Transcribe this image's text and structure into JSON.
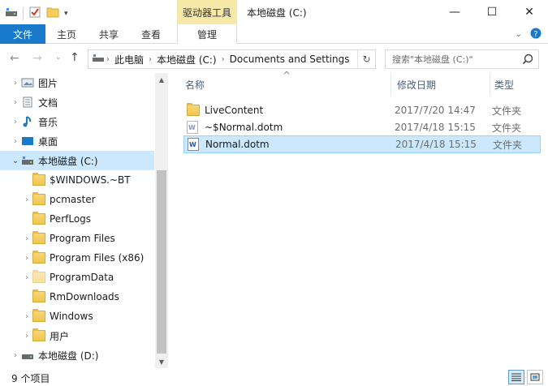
{
  "window": {
    "title": "本地磁盘 (C:)",
    "context_tab_group": "驱动器工具",
    "controls": {
      "minimize": "—",
      "maximize": "☐",
      "close": "✕"
    }
  },
  "ribbon": {
    "tabs": [
      "文件",
      "主页",
      "共享",
      "查看",
      "管理"
    ]
  },
  "address": {
    "crumbs": [
      "此电脑",
      "本地磁盘 (C:)",
      "Documents and Settings"
    ],
    "search_placeholder": "搜索\"本地磁盘 (C:)\""
  },
  "tree": {
    "items": [
      {
        "label": "图片",
        "icon": "pictures-icon"
      },
      {
        "label": "文档",
        "icon": "documents-icon"
      },
      {
        "label": "音乐",
        "icon": "music-icon"
      },
      {
        "label": "桌面",
        "icon": "desktop-icon"
      },
      {
        "label": "本地磁盘 (C:)",
        "icon": "drive-icon"
      },
      {
        "label": "$WINDOWS.~BT",
        "icon": "folder-icon"
      },
      {
        "label": "pcmaster",
        "icon": "folder-icon"
      },
      {
        "label": "PerfLogs",
        "icon": "folder-icon"
      },
      {
        "label": "Program Files",
        "icon": "folder-icon"
      },
      {
        "label": "Program Files (x86)",
        "icon": "folder-icon"
      },
      {
        "label": "ProgramData",
        "icon": "folder-icon"
      },
      {
        "label": "RmDownloads",
        "icon": "folder-icon"
      },
      {
        "label": "Windows",
        "icon": "folder-icon"
      },
      {
        "label": "用户",
        "icon": "folder-icon"
      },
      {
        "label": "本地磁盘 (D:)",
        "icon": "drive-icon"
      }
    ]
  },
  "columns": {
    "name": "名称",
    "modified": "修改日期",
    "type": "类型"
  },
  "files": [
    {
      "name": "LiveContent",
      "modified": "2017/7/20 14:47",
      "type": "文件夹"
    },
    {
      "name": "~$Normal.dotm",
      "modified": "2017/4/18 15:15",
      "type": "文件夹"
    },
    {
      "name": "Normal.dotm",
      "modified": "2017/4/18 15:15",
      "type": "文件夹"
    }
  ],
  "status": {
    "item_count": "9 个项目"
  },
  "colors": {
    "accent": "#1979ca",
    "selection": "#cce8ff",
    "context_tab": "#f6e9a8"
  }
}
